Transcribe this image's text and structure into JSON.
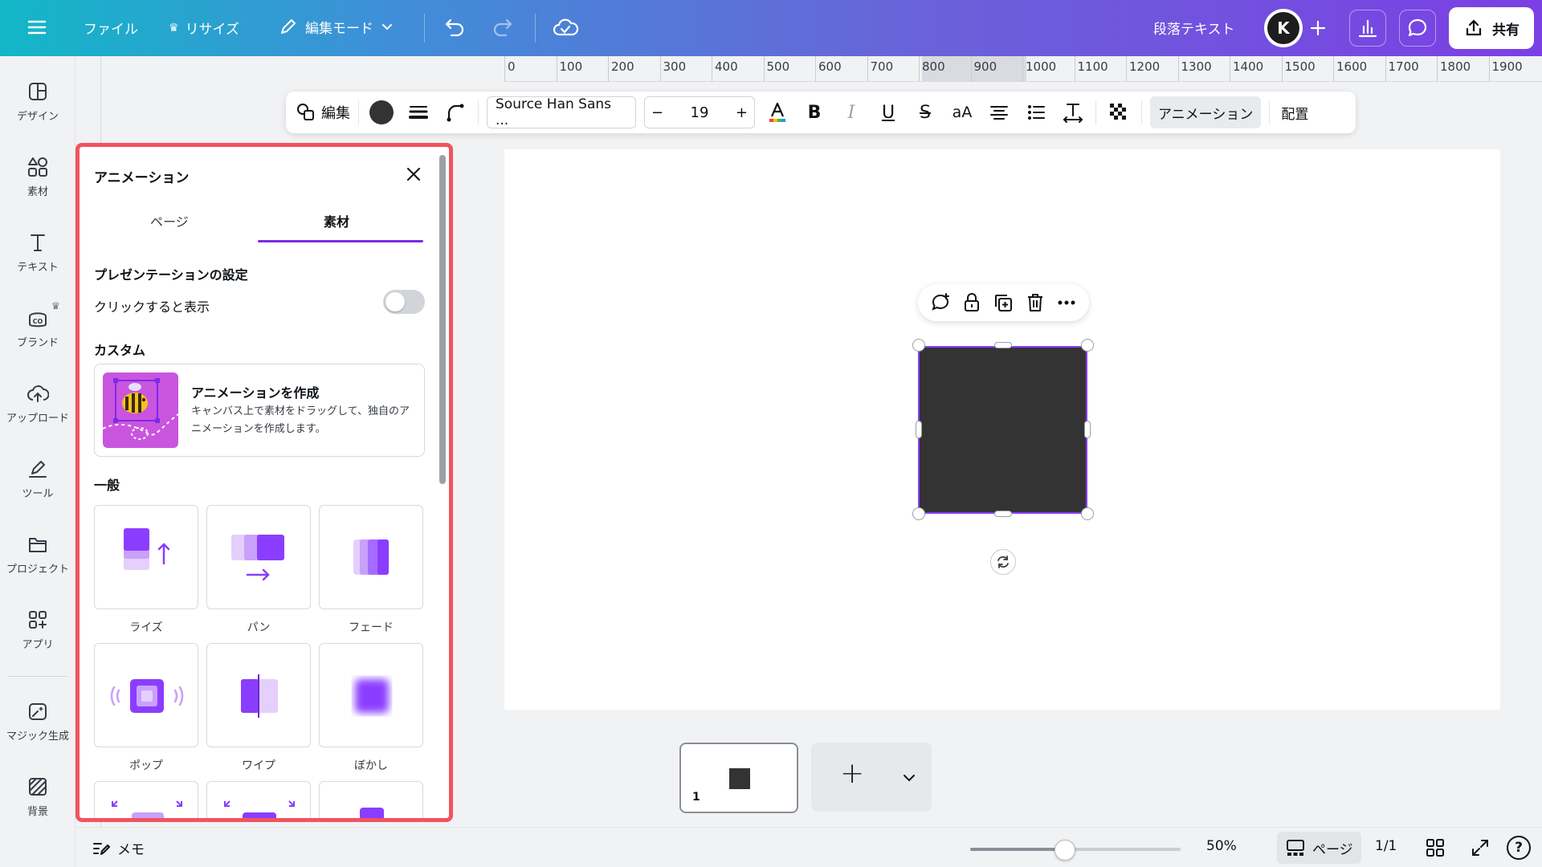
{
  "topbar": {
    "file_label": "ファイル",
    "resize_label": "リサイズ",
    "edit_mode_label": "編集モード",
    "element_type_label": "段落テキスト",
    "avatar_letter": "K",
    "share_label": "共有"
  },
  "rail": {
    "items": [
      {
        "label": "デザイン",
        "icon": "design-icon"
      },
      {
        "label": "素材",
        "icon": "elements-icon"
      },
      {
        "label": "テキスト",
        "icon": "text-icon"
      },
      {
        "label": "ブランド",
        "icon": "brand-icon"
      },
      {
        "label": "アップロード",
        "icon": "upload-icon"
      },
      {
        "label": "ツール",
        "icon": "tools-icon"
      },
      {
        "label": "プロジェクト",
        "icon": "projects-icon"
      },
      {
        "label": "アプリ",
        "icon": "apps-icon"
      },
      {
        "label": "マジック生成",
        "icon": "magic-icon"
      },
      {
        "label": "背景",
        "icon": "background-icon"
      }
    ]
  },
  "ruler": {
    "labels": [
      "0",
      "100",
      "200",
      "300",
      "400",
      "500",
      "600",
      "700",
      "800",
      "900",
      "1000",
      "1100",
      "1200",
      "1300",
      "1400",
      "1500",
      "1600",
      "1700",
      "1800",
      "1900"
    ]
  },
  "format_bar": {
    "edit_label": "編集",
    "font_name": "Source Han Sans ...",
    "font_size": "19",
    "minus": "−",
    "plus": "+",
    "case_label": "aA",
    "animation_label": "アニメーション",
    "position_label": "配置",
    "text_color": "#0e1318"
  },
  "panel": {
    "title": "アニメーション",
    "tabs": [
      "ページ",
      "素材"
    ],
    "active_tab": "素材",
    "presentation_heading": "プレゼンテーションの設定",
    "click_to_show_label": "クリックすると表示",
    "click_to_show_enabled": false,
    "custom_heading": "カスタム",
    "custom_card_title": "アニメーションを作成",
    "custom_card_desc": "キャンバス上で素材をドラッグして、独自のアニメーションを作成します。",
    "general_heading": "一般",
    "animations": [
      "ライズ",
      "パン",
      "フェード",
      "ポップ",
      "ワイプ",
      "ぼかし"
    ],
    "accent_color": "#7d2ae8"
  },
  "canvas": {
    "shape_color": "#333333",
    "selection_color": "#8b3dff"
  },
  "pages": {
    "current_page_number": "1",
    "add_symbol": "+"
  },
  "bottombar": {
    "notes_label": "メモ",
    "zoom_level": "50%",
    "zoom_fraction": 0.45,
    "pages_label": "ページ",
    "page_count": "1/1",
    "help_symbol": "?"
  }
}
